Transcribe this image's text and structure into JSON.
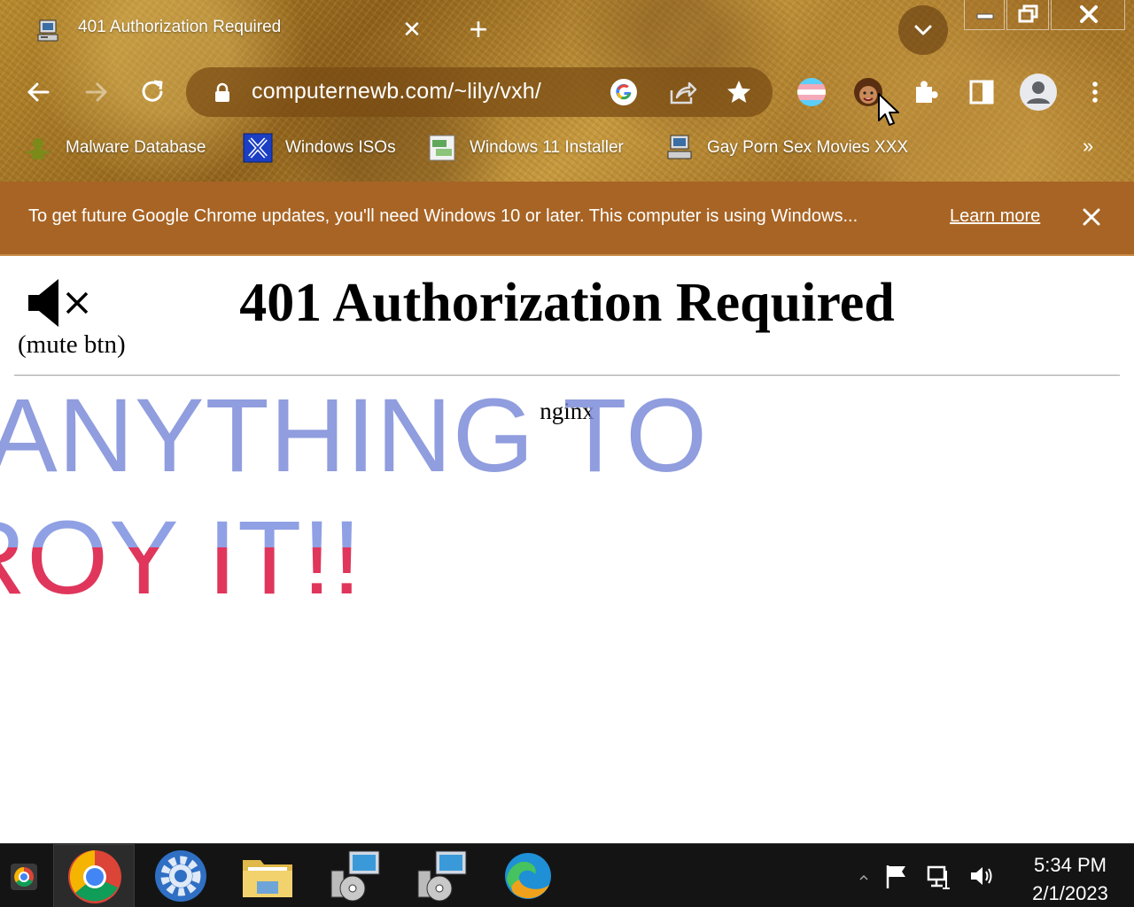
{
  "tab": {
    "title": "401 Authorization Required",
    "close_symbol": "✕",
    "new_tab_symbol": "+"
  },
  "toolbar": {
    "url": "computernewb.com/~lily/vxh/"
  },
  "bookmarks": {
    "items": [
      {
        "label": "Malware Database"
      },
      {
        "label": "Windows ISOs"
      },
      {
        "label": "Windows 11 Installer"
      },
      {
        "label": "Gay Porn Sex Movies XXX"
      }
    ],
    "more_symbol": "»"
  },
  "infobar": {
    "message": "To get future Google Chrome updates, you'll need Windows 10 or later. This computer is using Windows...",
    "link": "Learn more"
  },
  "page": {
    "heading": "401 Authorization Required",
    "mute_label": "(mute btn)",
    "server": "nginx",
    "overlay_line1": "ANYTHING TO",
    "overlay_line2": "ROY IT!!"
  },
  "taskbar": {
    "time": "5:34 PM",
    "date": "2/1/2023"
  },
  "colors": {
    "infobar_bg": "#a86424",
    "overlay_blue": "#7887d7",
    "overlay_red": "#e0365c",
    "taskbar_bg": "#141414"
  }
}
